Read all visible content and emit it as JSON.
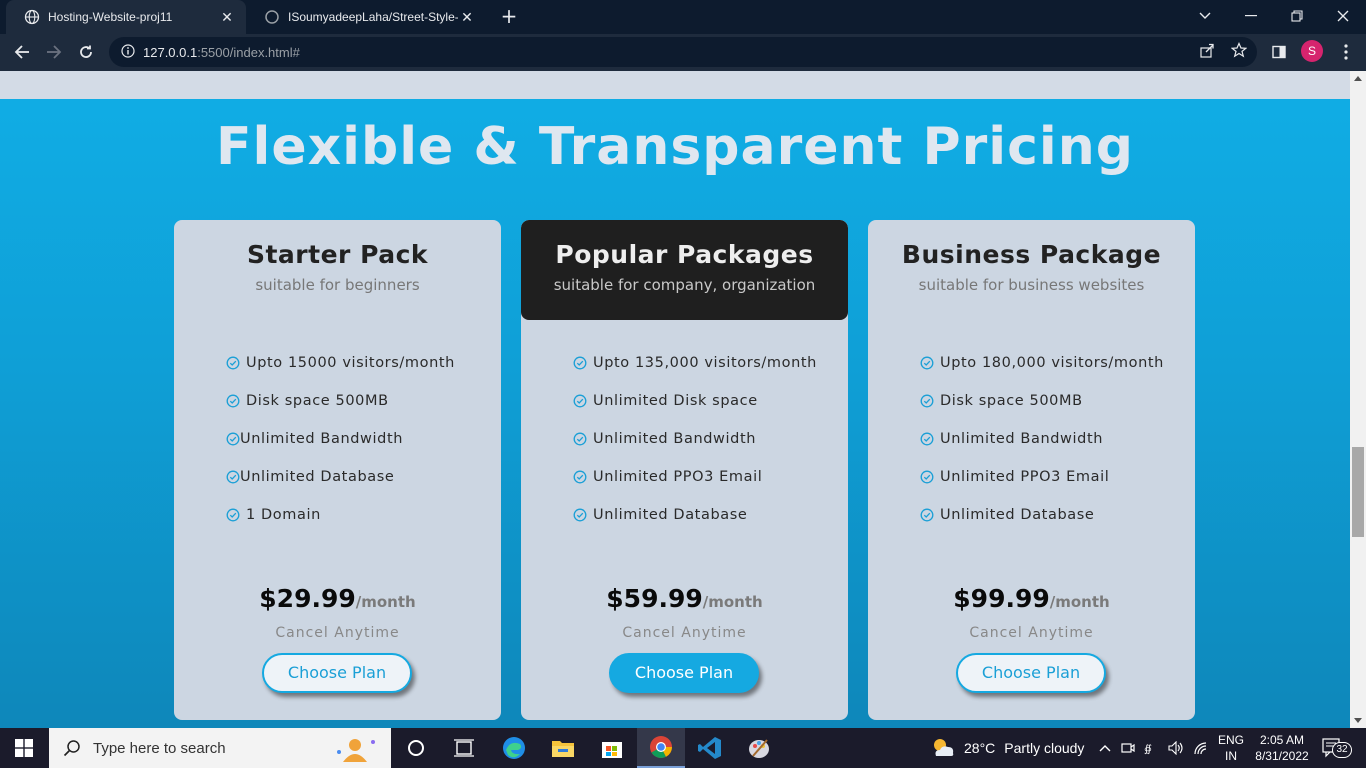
{
  "browser": {
    "tabs": [
      {
        "title": "Hosting-Website-proj11",
        "active": true
      },
      {
        "title": "ISoumyadeepLaha/Street-Style-L",
        "active": false
      }
    ],
    "url_host": "127.0.0.1",
    "url_path": ":5500/index.html#",
    "profile_initial": "S"
  },
  "page": {
    "heading": "Flexible & Transparent Pricing",
    "plans": [
      {
        "name": "Starter Pack",
        "subtitle": "suitable for beginners",
        "features": [
          "Upto 15000 visitors/month",
          "Disk space 500MB",
          "Unlimited Bandwidth",
          "Unlimited Database",
          "1 Domain"
        ],
        "price": "$29.99",
        "period": "/month",
        "cancel": "Cancel Anytime",
        "button": "Choose Plan"
      },
      {
        "name": "Popular Packages",
        "subtitle": "suitable for company, organization",
        "features": [
          "Upto 135,000 visitors/month",
          "Unlimited Disk space",
          "Unlimited Bandwidth",
          "Unlimited PPO3 Email",
          "Unlimited Database"
        ],
        "price": "$59.99",
        "period": "/month",
        "cancel": "Cancel Anytime",
        "button": "Choose Plan"
      },
      {
        "name": "Business Package",
        "subtitle": "suitable for business websites",
        "features": [
          "Upto 180,000 visitors/month",
          "Disk space 500MB",
          "Unlimited Bandwidth",
          "Unlimited PPO3 Email",
          "Unlimited Database"
        ],
        "price": "$99.99",
        "period": "/month",
        "cancel": "Cancel Anytime",
        "button": "Choose Plan"
      }
    ],
    "colors": {
      "accent": "#15a9e1",
      "card_bg": "#ccd6e2",
      "featured_head": "#1f1f1f"
    }
  },
  "taskbar": {
    "search_placeholder": "Type here to search",
    "weather_temp": "28°C",
    "weather_text": "Partly cloudy",
    "lang_1": "ENG",
    "lang_2": "IN",
    "time": "2:05 AM",
    "date": "8/31/2022",
    "notification_count": "32",
    "apps": [
      "cortana-icon",
      "task-view-icon",
      "edge-icon",
      "file-explorer-icon",
      "store-icon",
      "chrome-icon",
      "vscode-icon",
      "paint-icon"
    ]
  }
}
